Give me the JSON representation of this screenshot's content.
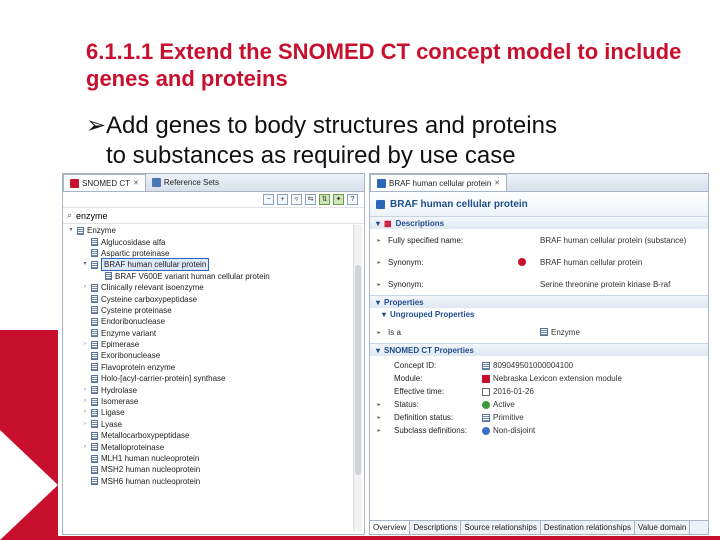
{
  "slide": {
    "title": "6.1.1.1 Extend the SNOMED CT concept model to include genes and proteins",
    "bullet_line1": "Add genes to body structures and proteins",
    "bullet_line2": "to substances as required by use case",
    "accent_color": "#c8102e"
  },
  "tree_panel": {
    "tabs": [
      {
        "label": "SNOMED CT",
        "icon": "snomed-icon"
      },
      {
        "label": "Reference Sets",
        "icon": "refset-icon"
      }
    ],
    "search_value": "enzyme",
    "items": [
      {
        "label": "Enzyme",
        "twisty": "▾",
        "indent": 0
      },
      {
        "label": "Alglucosidase alfa",
        "twisty": "",
        "indent": 1
      },
      {
        "label": "Aspartic proteinase",
        "twisty": "",
        "indent": 1
      },
      {
        "label": "BRAF human cellular protein",
        "twisty": "▾",
        "indent": 1,
        "selected": true
      },
      {
        "label": "BRAF V600E variant human cellular protein",
        "twisty": "",
        "indent": 2
      },
      {
        "label": "Clinically relevant isoenzyme",
        "twisty": "›",
        "indent": 1
      },
      {
        "label": "Cysteine carboxypeptidase",
        "twisty": "",
        "indent": 1
      },
      {
        "label": "Cysteine proteinase",
        "twisty": "",
        "indent": 1
      },
      {
        "label": "Endoribonuclease",
        "twisty": "",
        "indent": 1
      },
      {
        "label": "Enzyme variant",
        "twisty": "",
        "indent": 1
      },
      {
        "label": "Epimerase",
        "twisty": "›",
        "indent": 1
      },
      {
        "label": "Exoribonuclease",
        "twisty": "",
        "indent": 1
      },
      {
        "label": "Flavoprotein enzyme",
        "twisty": "",
        "indent": 1
      },
      {
        "label": "Holo-[acyl-carrier-protein] synthase",
        "twisty": "",
        "indent": 1
      },
      {
        "label": "Hydrolase",
        "twisty": "›",
        "indent": 1
      },
      {
        "label": "Isomerase",
        "twisty": "›",
        "indent": 1
      },
      {
        "label": "Ligase",
        "twisty": "›",
        "indent": 1
      },
      {
        "label": "Lyase",
        "twisty": "›",
        "indent": 1
      },
      {
        "label": "Metallocarboxypeptidase",
        "twisty": "",
        "indent": 1
      },
      {
        "label": "Metalloproteinase",
        "twisty": "›",
        "indent": 1
      },
      {
        "label": "MLH1 human nucleoprotein",
        "twisty": "",
        "indent": 1
      },
      {
        "label": "MSH2 human nucleoprotein",
        "twisty": "",
        "indent": 1
      },
      {
        "label": "MSH6 human nucleoprotein",
        "twisty": "",
        "indent": 1
      }
    ]
  },
  "detail_panel": {
    "tab_label": "BRAF human cellular protein",
    "header_title": "BRAF human cellular protein",
    "descriptions": {
      "section_label": "Descriptions",
      "rows": [
        {
          "key": "Fully specified name:",
          "value": "BRAF human cellular protein (substance)"
        },
        {
          "key": "Synonym:",
          "value": "BRAF human cellular protein",
          "preferred": true
        },
        {
          "key": "Synonym:",
          "value": "Serine threonine protein kinase B-raf"
        }
      ]
    },
    "properties": {
      "section_label": "Properties",
      "ungrouped_label": "Ungrouped Properties",
      "is_a_key": "Is a",
      "is_a_value": "Enzyme"
    },
    "snomed_properties": {
      "section_label": "SNOMED CT Properties",
      "rows": [
        {
          "key": "Concept ID:",
          "value": "809049501000004100",
          "icon": "doc"
        },
        {
          "key": "Module:",
          "value": "Nebraska Lexicon extension module",
          "icon": "red"
        },
        {
          "key": "Effective time:",
          "value": "2016-01-26",
          "icon": "cal"
        },
        {
          "key": "Status:",
          "value": "Active",
          "icon": "green"
        },
        {
          "key": "Definition status:",
          "value": "Primitive",
          "icon": "doc"
        },
        {
          "key": "Subclass definitions:",
          "value": "Non-disjoint",
          "icon": "blue"
        }
      ]
    },
    "bottom_tabs": [
      "Overview",
      "Descriptions",
      "Source relationships",
      "Destination relationships",
      "Value domain"
    ]
  }
}
